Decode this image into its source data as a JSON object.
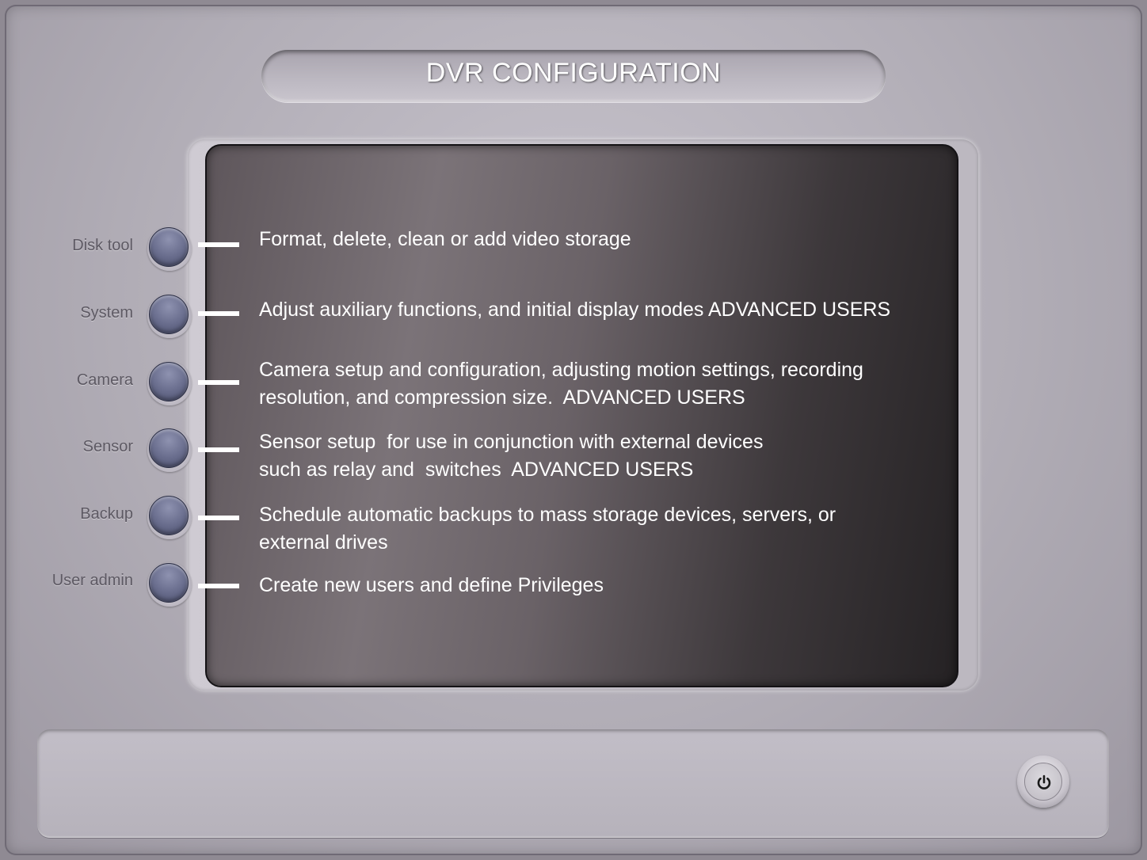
{
  "window": {
    "title": "DVR CONFIGURATION"
  },
  "menu": [
    {
      "id": "disk-tool",
      "label": "Disk tool",
      "description": "Format, delete, clean or add video storage"
    },
    {
      "id": "system",
      "label": "System",
      "description": "Adjust auxiliary functions, and initial display modes ADVANCED USERS"
    },
    {
      "id": "camera",
      "label": "Camera",
      "description": "Camera setup and configuration, adjusting motion settings, recording\nresolution, and compression size.  ADVANCED USERS"
    },
    {
      "id": "sensor",
      "label": "Sensor",
      "description": "Sensor setup  for use in conjunction with external devices\nsuch as relay and  switches  ADVANCED USERS"
    },
    {
      "id": "backup",
      "label": "Backup",
      "description": "Schedule automatic backups to mass storage devices, servers, or\nexternal drives"
    },
    {
      "id": "user-admin",
      "label": "User admin",
      "description": "Create new users and define Privileges"
    }
  ],
  "footer": {
    "power_icon": "power-icon"
  },
  "colors": {
    "button_blue": "#6b6f8f",
    "screen_dark": "#3d383b",
    "panel_gray": "#b1adb6"
  }
}
